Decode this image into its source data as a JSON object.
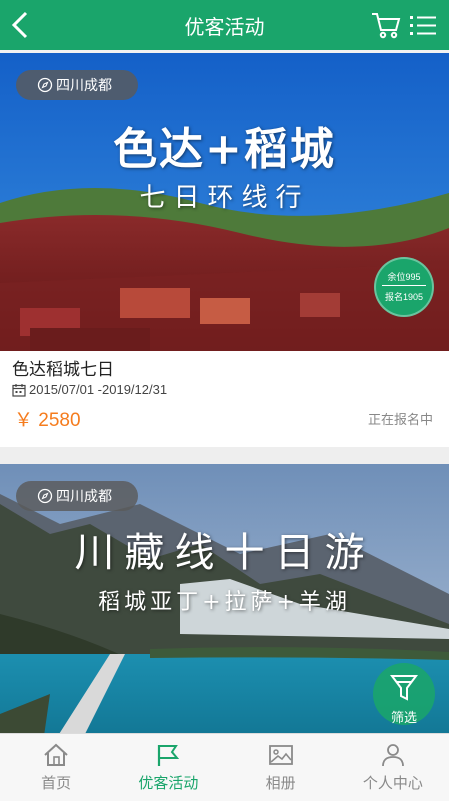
{
  "header": {
    "title": "优客活动",
    "back_icon": "chevron-left-icon",
    "cart_icon": "cart-icon",
    "menu_icon": "list-menu-icon"
  },
  "activities": [
    {
      "location": "四川成都",
      "banner_title": "色达+稻城",
      "banner_subtitle": "七日环线行",
      "seats_left": "余位995",
      "signed_up": "报名1905",
      "name": "色达稻城七日",
      "date_range": "2015/07/01 -2019/12/31",
      "price": "￥ 2580",
      "status": "正在报名中"
    },
    {
      "location": "四川成都",
      "banner_title": "川藏线十日游",
      "banner_subtitle": "稻城亚丁+拉萨+羊湖"
    }
  ],
  "filter": {
    "label": "筛选"
  },
  "tabs": [
    {
      "label": "首页",
      "icon": "home-icon"
    },
    {
      "label": "优客活动",
      "icon": "flag-icon"
    },
    {
      "label": "相册",
      "icon": "picture-icon"
    },
    {
      "label": "个人中心",
      "icon": "person-icon"
    }
  ],
  "colors": {
    "brand": "#1aa56b",
    "price": "#f57c1e"
  }
}
